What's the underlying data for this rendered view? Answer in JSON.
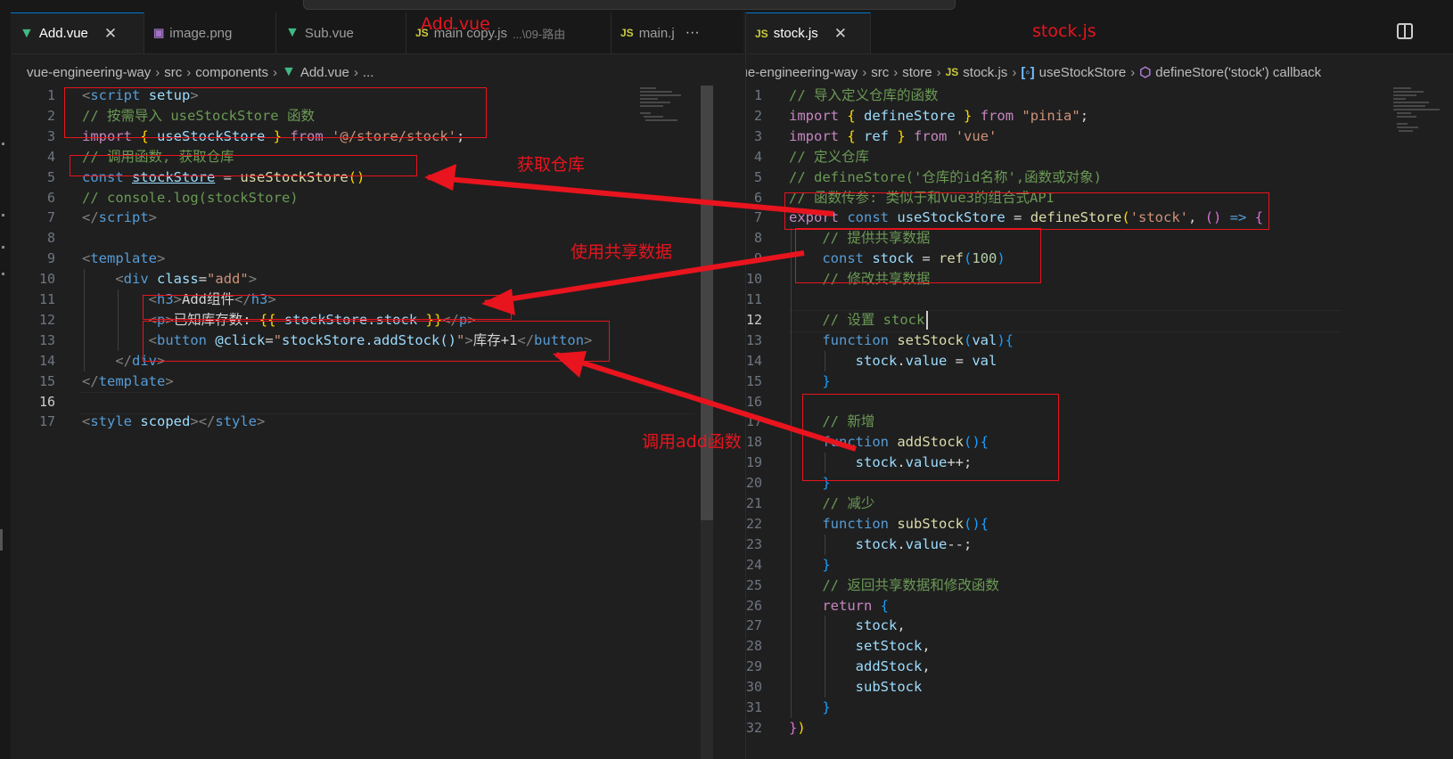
{
  "left_pane": {
    "tabs": [
      {
        "icon": "vue-icon",
        "label": "Add.vue",
        "close": "✕",
        "active": true
      },
      {
        "icon": "image-icon",
        "label": "image.png",
        "active": false
      },
      {
        "icon": "vue-icon",
        "label": "Sub.vue",
        "active": false
      },
      {
        "icon": "js-icon",
        "label": "main copy.js",
        "detail": "...\\09-路由",
        "active": false
      },
      {
        "icon": "js-icon",
        "label": "main.j",
        "more": "···",
        "active": false
      }
    ],
    "breadcrumb": [
      "vue-engineering-way",
      "src",
      "components",
      "Add.vue",
      "..."
    ],
    "line_numbers": [
      "1",
      "2",
      "3",
      "4",
      "5",
      "6",
      "7",
      "8",
      "9",
      "10",
      "11",
      "12",
      "13",
      "14",
      "15",
      "16",
      "17"
    ],
    "current_line": "16",
    "code": [
      [
        {
          "t": "<",
          "c": "c-tagp"
        },
        {
          "t": "script",
          "c": "c-tag"
        },
        {
          "t": " ",
          "c": "c-txt"
        },
        {
          "t": "setup",
          "c": "c-attr"
        },
        {
          "t": ">",
          "c": "c-tagp"
        }
      ],
      [
        {
          "t": "// 按需导入 useStockStore 函数",
          "c": "c-cm"
        }
      ],
      [
        {
          "t": "import",
          "c": "c-ctl"
        },
        {
          "t": " ",
          "c": "c-txt"
        },
        {
          "t": "{",
          "c": "c-br1"
        },
        {
          "t": " useStockStore ",
          "c": "c-var"
        },
        {
          "t": "}",
          "c": "c-br1"
        },
        {
          "t": " ",
          "c": "c-txt"
        },
        {
          "t": "from",
          "c": "c-ctl"
        },
        {
          "t": " ",
          "c": "c-txt"
        },
        {
          "t": "'@/store/stock'",
          "c": "c-str"
        },
        {
          "t": ";",
          "c": "c-txt"
        }
      ],
      [
        {
          "t": "// 调用函数, 获取仓库",
          "c": "c-cm"
        }
      ],
      [
        {
          "t": "const",
          "c": "c-kw"
        },
        {
          "t": " ",
          "c": "c-txt"
        },
        {
          "t": "stockStore",
          "c": "c-var u"
        },
        {
          "t": " = ",
          "c": "c-txt"
        },
        {
          "t": "useStockStore",
          "c": "c-fn"
        },
        {
          "t": "()",
          "c": "c-br1"
        }
      ],
      [
        {
          "t": "// console.log(stockStore)",
          "c": "c-cm"
        }
      ],
      [
        {
          "t": "</",
          "c": "c-tagp"
        },
        {
          "t": "script",
          "c": "c-tag"
        },
        {
          "t": ">",
          "c": "c-tagp"
        }
      ],
      [],
      [
        {
          "t": "<",
          "c": "c-tagp"
        },
        {
          "t": "template",
          "c": "c-tag"
        },
        {
          "t": ">",
          "c": "c-tagp"
        }
      ],
      [
        {
          "t": "    ",
          "c": "c-txt"
        },
        {
          "t": "<",
          "c": "c-tagp"
        },
        {
          "t": "div",
          "c": "c-tag"
        },
        {
          "t": " ",
          "c": "c-txt"
        },
        {
          "t": "class",
          "c": "c-attr"
        },
        {
          "t": "=",
          "c": "c-txt"
        },
        {
          "t": "\"add\"",
          "c": "c-str"
        },
        {
          "t": ">",
          "c": "c-tagp"
        }
      ],
      [
        {
          "t": "        ",
          "c": "c-txt"
        },
        {
          "t": "<",
          "c": "c-tagp"
        },
        {
          "t": "h3",
          "c": "c-tag"
        },
        {
          "t": ">",
          "c": "c-tagp"
        },
        {
          "t": "Add组件",
          "c": "c-txt"
        },
        {
          "t": "</",
          "c": "c-tagp"
        },
        {
          "t": "h3",
          "c": "c-tag"
        },
        {
          "t": ">",
          "c": "c-tagp"
        }
      ],
      [
        {
          "t": "        ",
          "c": "c-txt"
        },
        {
          "t": "<",
          "c": "c-tagp"
        },
        {
          "t": "p",
          "c": "c-tag"
        },
        {
          "t": ">",
          "c": "c-tagp"
        },
        {
          "t": "已知库存数: ",
          "c": "c-txt"
        },
        {
          "t": "{{",
          "c": "c-br1"
        },
        {
          "t": " stockStore.stock ",
          "c": "c-var"
        },
        {
          "t": "}}",
          "c": "c-br1"
        },
        {
          "t": "</",
          "c": "c-tagp"
        },
        {
          "t": "p",
          "c": "c-tag"
        },
        {
          "t": ">",
          "c": "c-tagp"
        }
      ],
      [
        {
          "t": "        ",
          "c": "c-txt"
        },
        {
          "t": "<",
          "c": "c-tagp"
        },
        {
          "t": "button",
          "c": "c-tag"
        },
        {
          "t": " ",
          "c": "c-txt"
        },
        {
          "t": "@click",
          "c": "c-attr"
        },
        {
          "t": "=",
          "c": "c-txt"
        },
        {
          "t": "\"",
          "c": "c-str"
        },
        {
          "t": "stockStore.addStock()",
          "c": "c-var"
        },
        {
          "t": "\"",
          "c": "c-str"
        },
        {
          "t": ">",
          "c": "c-tagp"
        },
        {
          "t": "库存+1",
          "c": "c-txt"
        },
        {
          "t": "</",
          "c": "c-tagp"
        },
        {
          "t": "button",
          "c": "c-tag"
        },
        {
          "t": ">",
          "c": "c-tagp"
        }
      ],
      [
        {
          "t": "    ",
          "c": "c-txt"
        },
        {
          "t": "</",
          "c": "c-tagp"
        },
        {
          "t": "div",
          "c": "c-tag"
        },
        {
          "t": ">",
          "c": "c-tagp"
        }
      ],
      [
        {
          "t": "</",
          "c": "c-tagp"
        },
        {
          "t": "template",
          "c": "c-tag"
        },
        {
          "t": ">",
          "c": "c-tagp"
        }
      ],
      [],
      [
        {
          "t": "<",
          "c": "c-tagp"
        },
        {
          "t": "style",
          "c": "c-tag"
        },
        {
          "t": " ",
          "c": "c-txt"
        },
        {
          "t": "scoped",
          "c": "c-attr"
        },
        {
          "t": "></",
          "c": "c-tagp"
        },
        {
          "t": "style",
          "c": "c-tag"
        },
        {
          "t": ">",
          "c": "c-tagp"
        }
      ]
    ]
  },
  "right_pane": {
    "tabs": [
      {
        "icon": "js-icon",
        "label": "stock.js",
        "close": "✕",
        "active": true
      }
    ],
    "breadcrumb": [
      "vue-engineering-way",
      "src",
      "store",
      "stock.js",
      "useStockStore",
      "defineStore('stock') callback"
    ],
    "line_numbers": [
      "1",
      "2",
      "3",
      "4",
      "5",
      "6",
      "7",
      "8",
      "9",
      "10",
      "11",
      "12",
      "13",
      "14",
      "15",
      "16",
      "17",
      "18",
      "19",
      "20",
      "21",
      "22",
      "23",
      "24",
      "25",
      "26",
      "27",
      "28",
      "29",
      "30",
      "31",
      "32"
    ],
    "current_line": "12",
    "code": [
      [
        {
          "t": "// 导入定义仓库的函数",
          "c": "c-cm"
        }
      ],
      [
        {
          "t": "import",
          "c": "c-ctl"
        },
        {
          "t": " ",
          "c": "c-txt"
        },
        {
          "t": "{",
          "c": "c-br1"
        },
        {
          "t": " defineStore ",
          "c": "c-var"
        },
        {
          "t": "}",
          "c": "c-br1"
        },
        {
          "t": " ",
          "c": "c-txt"
        },
        {
          "t": "from",
          "c": "c-ctl"
        },
        {
          "t": " ",
          "c": "c-txt"
        },
        {
          "t": "\"pinia\"",
          "c": "c-str"
        },
        {
          "t": ";",
          "c": "c-txt"
        }
      ],
      [
        {
          "t": "import",
          "c": "c-ctl"
        },
        {
          "t": " ",
          "c": "c-txt"
        },
        {
          "t": "{",
          "c": "c-br1"
        },
        {
          "t": " ref ",
          "c": "c-var"
        },
        {
          "t": "}",
          "c": "c-br1"
        },
        {
          "t": " ",
          "c": "c-txt"
        },
        {
          "t": "from",
          "c": "c-ctl"
        },
        {
          "t": " ",
          "c": "c-txt"
        },
        {
          "t": "'vue'",
          "c": "c-str"
        }
      ],
      [
        {
          "t": "// 定义仓库",
          "c": "c-cm"
        }
      ],
      [
        {
          "t": "// defineStore('仓库的id名称',函数或对象)",
          "c": "c-cm"
        }
      ],
      [
        {
          "t": "// 函数传参: 类似于和Vue3的组合式API",
          "c": "c-cm"
        }
      ],
      [
        {
          "t": "export",
          "c": "c-ctl"
        },
        {
          "t": " ",
          "c": "c-txt"
        },
        {
          "t": "const",
          "c": "c-kw"
        },
        {
          "t": " ",
          "c": "c-txt"
        },
        {
          "t": "useStockStore",
          "c": "c-var"
        },
        {
          "t": " = ",
          "c": "c-txt"
        },
        {
          "t": "defineStore",
          "c": "c-fn"
        },
        {
          "t": "(",
          "c": "c-br1"
        },
        {
          "t": "'stock'",
          "c": "c-str"
        },
        {
          "t": ", ",
          "c": "c-txt"
        },
        {
          "t": "()",
          "c": "c-br2"
        },
        {
          "t": " ",
          "c": "c-txt"
        },
        {
          "t": "=>",
          "c": "c-kw"
        },
        {
          "t": " ",
          "c": "c-txt"
        },
        {
          "t": "{",
          "c": "c-br2"
        }
      ],
      [
        {
          "t": "    ",
          "c": "c-txt"
        },
        {
          "t": "// 提供共享数据",
          "c": "c-cm"
        }
      ],
      [
        {
          "t": "    ",
          "c": "c-txt"
        },
        {
          "t": "const",
          "c": "c-kw"
        },
        {
          "t": " ",
          "c": "c-txt"
        },
        {
          "t": "stock",
          "c": "c-var"
        },
        {
          "t": " = ",
          "c": "c-txt"
        },
        {
          "t": "ref",
          "c": "c-fn"
        },
        {
          "t": "(",
          "c": "c-br3"
        },
        {
          "t": "100",
          "c": "c-num"
        },
        {
          "t": ")",
          "c": "c-br3"
        }
      ],
      [
        {
          "t": "    ",
          "c": "c-txt"
        },
        {
          "t": "// 修改共享数据",
          "c": "c-cm"
        }
      ],
      [],
      [
        {
          "t": "    ",
          "c": "c-txt"
        },
        {
          "t": "// 设置 stock",
          "c": "c-cm"
        }
      ],
      [
        {
          "t": "    ",
          "c": "c-txt"
        },
        {
          "t": "function",
          "c": "c-kw"
        },
        {
          "t": " ",
          "c": "c-txt"
        },
        {
          "t": "setStock",
          "c": "c-fn"
        },
        {
          "t": "(",
          "c": "c-br3"
        },
        {
          "t": "val",
          "c": "c-var"
        },
        {
          "t": ")",
          "c": "c-br3"
        },
        {
          "t": "{",
          "c": "c-br3"
        }
      ],
      [
        {
          "t": "        ",
          "c": "c-txt"
        },
        {
          "t": "stock",
          "c": "c-var"
        },
        {
          "t": ".",
          "c": "c-txt"
        },
        {
          "t": "value",
          "c": "c-var"
        },
        {
          "t": " = ",
          "c": "c-txt"
        },
        {
          "t": "val",
          "c": "c-var"
        }
      ],
      [
        {
          "t": "    ",
          "c": "c-txt"
        },
        {
          "t": "}",
          "c": "c-br3"
        }
      ],
      [],
      [
        {
          "t": "    ",
          "c": "c-txt"
        },
        {
          "t": "// 新增",
          "c": "c-cm"
        }
      ],
      [
        {
          "t": "    ",
          "c": "c-txt"
        },
        {
          "t": "function",
          "c": "c-kw"
        },
        {
          "t": " ",
          "c": "c-txt"
        },
        {
          "t": "addStock",
          "c": "c-fn"
        },
        {
          "t": "()",
          "c": "c-br3"
        },
        {
          "t": "{",
          "c": "c-br3"
        }
      ],
      [
        {
          "t": "        ",
          "c": "c-txt"
        },
        {
          "t": "stock",
          "c": "c-var"
        },
        {
          "t": ".",
          "c": "c-txt"
        },
        {
          "t": "value",
          "c": "c-var"
        },
        {
          "t": "++;",
          "c": "c-txt"
        }
      ],
      [
        {
          "t": "    ",
          "c": "c-txt"
        },
        {
          "t": "}",
          "c": "c-br3"
        }
      ],
      [
        {
          "t": "    ",
          "c": "c-txt"
        },
        {
          "t": "// 减少",
          "c": "c-cm"
        }
      ],
      [
        {
          "t": "    ",
          "c": "c-txt"
        },
        {
          "t": "function",
          "c": "c-kw"
        },
        {
          "t": " ",
          "c": "c-txt"
        },
        {
          "t": "subStock",
          "c": "c-fn"
        },
        {
          "t": "()",
          "c": "c-br3"
        },
        {
          "t": "{",
          "c": "c-br3"
        }
      ],
      [
        {
          "t": "        ",
          "c": "c-txt"
        },
        {
          "t": "stock",
          "c": "c-var"
        },
        {
          "t": ".",
          "c": "c-txt"
        },
        {
          "t": "value",
          "c": "c-var"
        },
        {
          "t": "--;",
          "c": "c-txt"
        }
      ],
      [
        {
          "t": "    ",
          "c": "c-txt"
        },
        {
          "t": "}",
          "c": "c-br3"
        }
      ],
      [
        {
          "t": "    ",
          "c": "c-txt"
        },
        {
          "t": "// 返回共享数据和修改函数",
          "c": "c-cm"
        }
      ],
      [
        {
          "t": "    ",
          "c": "c-txt"
        },
        {
          "t": "return",
          "c": "c-ctl"
        },
        {
          "t": " ",
          "c": "c-txt"
        },
        {
          "t": "{",
          "c": "c-br3"
        }
      ],
      [
        {
          "t": "        ",
          "c": "c-txt"
        },
        {
          "t": "stock",
          "c": "c-var"
        },
        {
          "t": ",",
          "c": "c-txt"
        }
      ],
      [
        {
          "t": "        ",
          "c": "c-txt"
        },
        {
          "t": "setStock",
          "c": "c-var"
        },
        {
          "t": ",",
          "c": "c-txt"
        }
      ],
      [
        {
          "t": "        ",
          "c": "c-txt"
        },
        {
          "t": "addStock",
          "c": "c-var"
        },
        {
          "t": ",",
          "c": "c-txt"
        }
      ],
      [
        {
          "t": "        ",
          "c": "c-txt"
        },
        {
          "t": "subStock",
          "c": "c-var"
        }
      ],
      [
        {
          "t": "    ",
          "c": "c-txt"
        },
        {
          "t": "}",
          "c": "c-br3"
        }
      ],
      [
        {
          "t": "}",
          "c": "c-br2"
        },
        {
          "t": ")",
          "c": "c-br1"
        }
      ]
    ]
  },
  "annotations": {
    "title_left": "Add.vue",
    "title_right": "stock.js",
    "get_store": "获取仓库",
    "use_shared_data": "使用共享数据",
    "call_add": "调用add函数"
  },
  "colors": {
    "annotation_red": "#e8141e",
    "editor_bg": "#1f1f1f",
    "tab_bar_bg": "#181818",
    "accent": "#0078d4"
  }
}
